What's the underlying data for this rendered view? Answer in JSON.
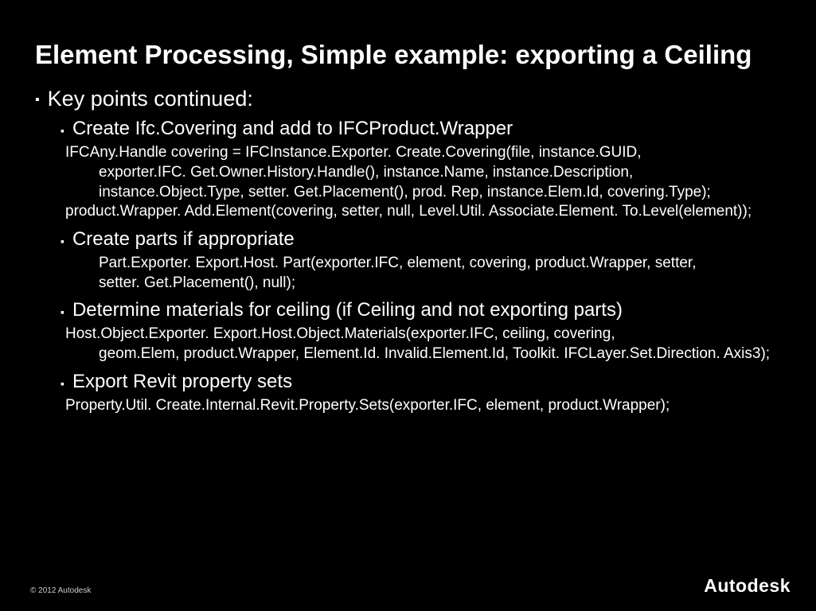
{
  "title": "Element Processing, Simple example: exporting a Ceiling",
  "main": {
    "heading": "Key points continued:",
    "items": [
      {
        "label": "Create Ifc.Covering and add to IFCProduct.Wrapper",
        "code": [
          "IFCAny.Handle covering = IFCInstance.Exporter. Create.Covering(file, instance.GUID,",
          "exporter.IFC. Get.Owner.History.Handle(), instance.Name, instance.Description,",
          "instance.Object.Type, setter. Get.Placement(), prod. Rep, instance.Elem.Id, covering.Type);",
          "product.Wrapper. Add.Element(covering, setter, null, Level.Util. Associate.Element. To.Level(element));"
        ],
        "indentFlags": [
          false,
          true,
          true,
          false
        ]
      },
      {
        "label": "Create parts if appropriate",
        "code": [
          "Part.Exporter. Export.Host. Part(exporter.IFC, element, covering, product.Wrapper, setter,",
          "setter. Get.Placement(), null);"
        ],
        "indentFlags": [
          true,
          true
        ]
      },
      {
        "label": "Determine materials for ceiling (if Ceiling and not exporting parts)",
        "code": [
          "Host.Object.Exporter. Export.Host.Object.Materials(exporter.IFC, ceiling, covering,",
          "geom.Elem, product.Wrapper, Element.Id. Invalid.Element.Id, Toolkit. IFCLayer.Set.Direction. Axis3);"
        ],
        "indentFlags": [
          false,
          true
        ]
      },
      {
        "label": "Export Revit property sets",
        "code": [
          "Property.Util. Create.Internal.Revit.Property.Sets(exporter.IFC, element, product.Wrapper);"
        ],
        "indentFlags": [
          false
        ]
      }
    ]
  },
  "footer": {
    "copyright": "© 2012 Autodesk",
    "brand": "Autodesk"
  }
}
